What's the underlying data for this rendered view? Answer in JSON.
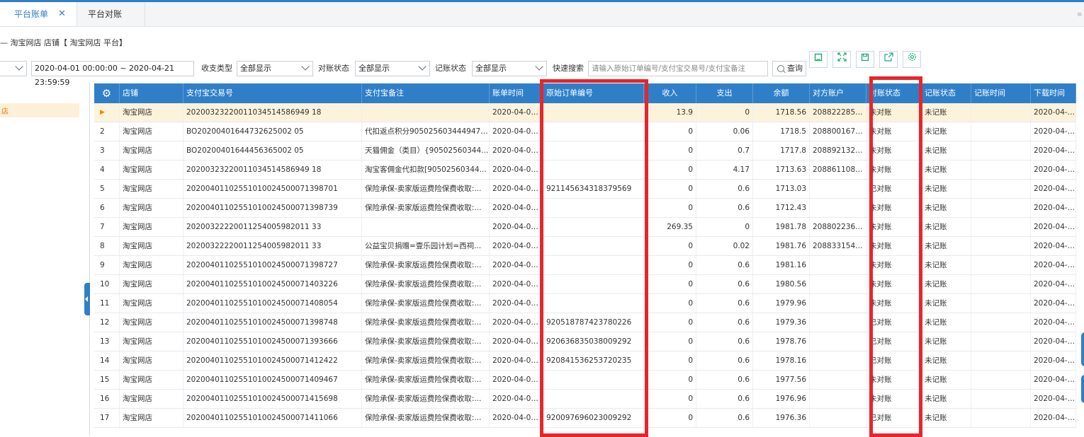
{
  "tabs": [
    {
      "label": "平台账单",
      "close": "✕",
      "active": true
    },
    {
      "label": "平台对账",
      "active": false
    }
  ],
  "breadcrumb": "— 淘宝网店 店铺【 淘宝网店 平台】",
  "filters": {
    "date_range": "2020-04-01 00:00:00 ~ 2020-04-21 23:59:59",
    "pay_type_label": "收支类型",
    "pay_type_value": "全部显示",
    "recon_label": "对账状态",
    "recon_value": "全部显示",
    "book_label": "记账状态",
    "book_value": "全部显示",
    "search_label": "快速搜索",
    "search_placeholder": "请输入原始订单编号/支付宝交易号/支付宝备注",
    "query_label": "查询"
  },
  "toolbar_icons": [
    "square-icon",
    "expand-icon",
    "save-icon",
    "export-icon",
    "settings-icon"
  ],
  "left_panel": {
    "selected_item": "店"
  },
  "columns": [
    "⚙",
    "店铺",
    "支付宝交易号",
    "支付宝备注",
    "账单时间",
    "原始订单编号",
    "收入",
    "支出",
    "余额",
    "对方账户",
    "对账状态",
    "记账状态",
    "记账时间",
    "下载时间"
  ],
  "rows": [
    {
      "idx": "▶",
      "shop": "淘宝网店",
      "trade_no": "20200323220011034514586949 18",
      "memo": "",
      "time": "2020-04-01 ...",
      "order_no": "",
      "income": "13.9",
      "expense": "0",
      "balance": "1718.56",
      "account": "20882228595...",
      "recon": "未对账",
      "book": "未记账",
      "book_time": "",
      "download": "2020-04-16 ..."
    },
    {
      "idx": "2",
      "shop": "淘宝网店",
      "trade_no": "BO20200401644732625002 05",
      "memo": "代扣返点积分9050256034449475...",
      "time": "2020-04-01 ...",
      "order_no": "",
      "income": "0",
      "expense": "0.06",
      "balance": "1718.5",
      "account": "20880016748...",
      "recon": "未对账",
      "book": "未记账",
      "book_time": "",
      "download": "2020-04-16 ..."
    },
    {
      "idx": "3",
      "shop": "淘宝网店",
      "trade_no": "BO20200401644456365002 05",
      "memo": "天猫佣金（类目）{90502560344...",
      "time": "2020-04-01 ...",
      "order_no": "",
      "income": "0",
      "expense": "0.7",
      "balance": "1717.8",
      "account": "20889213299...",
      "recon": "未对账",
      "book": "未记账",
      "book_time": "",
      "download": "2020-04-16 ..."
    },
    {
      "idx": "4",
      "shop": "淘宝网店",
      "trade_no": "20200323220011034514586949 18",
      "memo": "淘宝客佣金代扣款[90502560344...",
      "time": "2020-04-01 ...",
      "order_no": "",
      "income": "0",
      "expense": "4.17",
      "balance": "1713.63",
      "account": "20886110874...",
      "recon": "未对账",
      "book": "未记账",
      "book_time": "",
      "download": "2020-04-16 ..."
    },
    {
      "idx": "5",
      "shop": "淘宝网店",
      "trade_no": "20200401102551010024500071398701",
      "memo": "保险承保-卖家版运费险保费收取:...",
      "time": "2020-04-01 ...",
      "order_no": "921145634318379569",
      "income": "0",
      "expense": "0.6",
      "balance": "1713.03",
      "account": "",
      "recon": "已对账",
      "book": "未记账",
      "book_time": "",
      "download": "2020-04-16 ..."
    },
    {
      "idx": "6",
      "shop": "淘宝网店",
      "trade_no": "20200401102551010024500071398739",
      "memo": "保险承保-卖家版运费险保费收取:...",
      "time": "2020-04-01 ...",
      "order_no": "",
      "income": "0",
      "expense": "0.6",
      "balance": "1712.43",
      "account": "",
      "recon": "未对账",
      "book": "未记账",
      "book_time": "",
      "download": "2020-04-16 ..."
    },
    {
      "idx": "7",
      "shop": "淘宝网店",
      "trade_no": "20200322220011254005982011 33",
      "memo": "",
      "time": "2020-04-01 ...",
      "order_no": "",
      "income": "269.35",
      "expense": "0",
      "balance": "1981.78",
      "account": "20880223620...",
      "recon": "未对账",
      "book": "未记账",
      "book_time": "",
      "download": "2020-04-16 ..."
    },
    {
      "idx": "8",
      "shop": "淘宝网店",
      "trade_no": "20200322220011254005982011 33",
      "memo": "公益宝贝捐赠=壹乐园计划=西祠...",
      "time": "2020-04-01 ...",
      "order_no": "",
      "income": "0",
      "expense": "0.02",
      "balance": "1981.76",
      "account": "20883315424...",
      "recon": "未对账",
      "book": "未记账",
      "book_time": "",
      "download": "2020-04-16 ..."
    },
    {
      "idx": "9",
      "shop": "淘宝网店",
      "trade_no": "20200401102551010024500071398727",
      "memo": "保险承保-卖家版运费险保费收取:...",
      "time": "2020-04-01 ...",
      "order_no": "",
      "income": "0",
      "expense": "0.6",
      "balance": "1981.16",
      "account": "",
      "recon": "未对账",
      "book": "未记账",
      "book_time": "",
      "download": "2020-04-16 ..."
    },
    {
      "idx": "10",
      "shop": "淘宝网店",
      "trade_no": "20200401102551010024500071403226",
      "memo": "保险承保-卖家版运费险保费收取:...",
      "time": "2020-04-01 ...",
      "order_no": "",
      "income": "0",
      "expense": "0.6",
      "balance": "1980.56",
      "account": "",
      "recon": "未对账",
      "book": "未记账",
      "book_time": "",
      "download": "2020-04-16 ..."
    },
    {
      "idx": "11",
      "shop": "淘宝网店",
      "trade_no": "20200401102551010024500071408054",
      "memo": "保险承保-卖家版运费险保费收取:...",
      "time": "2020-04-01 ...",
      "order_no": "",
      "income": "0",
      "expense": "0.6",
      "balance": "1979.96",
      "account": "",
      "recon": "未对账",
      "book": "未记账",
      "book_time": "",
      "download": "2020-04-16 ..."
    },
    {
      "idx": "12",
      "shop": "淘宝网店",
      "trade_no": "20200401102551010024500071398748",
      "memo": "保险承保-卖家版运费险保费收取:...",
      "time": "2020-04-01 ...",
      "order_no": "920518787423780226",
      "income": "0",
      "expense": "0.6",
      "balance": "1979.36",
      "account": "",
      "recon": "已对账",
      "book": "未记账",
      "book_time": "",
      "download": "2020-04-16 ..."
    },
    {
      "idx": "13",
      "shop": "淘宝网店",
      "trade_no": "20200401102551010024500071393666",
      "memo": "保险承保-卖家版运费险保费收取:...",
      "time": "2020-04-01 ...",
      "order_no": "920636835038009292",
      "income": "0",
      "expense": "0.6",
      "balance": "1978.76",
      "account": "",
      "recon": "已对账",
      "book": "未记账",
      "book_time": "",
      "download": "2020-04-16 ..."
    },
    {
      "idx": "14",
      "shop": "淘宝网店",
      "trade_no": "20200401102551010024500071412422",
      "memo": "保险承保-卖家版运费险保费收取:...",
      "time": "2020-04-01 ...",
      "order_no": "920841536253720235",
      "income": "0",
      "expense": "0.6",
      "balance": "1978.16",
      "account": "",
      "recon": "已对账",
      "book": "未记账",
      "book_time": "",
      "download": "2020-04-16 ..."
    },
    {
      "idx": "15",
      "shop": "淘宝网店",
      "trade_no": "20200401102551010024500071409467",
      "memo": "保险承保-卖家版运费险保费收取:...",
      "time": "2020-04-01 ...",
      "order_no": "",
      "income": "0",
      "expense": "0.6",
      "balance": "1977.56",
      "account": "",
      "recon": "未对账",
      "book": "未记账",
      "book_time": "",
      "download": "2020-04-16 ..."
    },
    {
      "idx": "16",
      "shop": "淘宝网店",
      "trade_no": "20200401102551010024500071415698",
      "memo": "保险承保-卖家版运费险保费收取:...",
      "time": "2020-04-01 ...",
      "order_no": "",
      "income": "0",
      "expense": "0.6",
      "balance": "1976.96",
      "account": "",
      "recon": "未对账",
      "book": "未记账",
      "book_time": "",
      "download": "2020-04-16 ..."
    },
    {
      "idx": "17",
      "shop": "淘宝网店",
      "trade_no": "20200401102551010024500071411066",
      "memo": "保险承保-卖家版运费险保费收取:...",
      "time": "2020-04-01 ...",
      "order_no": "920097696023009292",
      "income": "0",
      "expense": "0.6",
      "balance": "1976.36",
      "account": "",
      "recon": "已对账",
      "book": "未记账",
      "book_time": "",
      "download": "2020-04-16 ..."
    }
  ],
  "colors": {
    "accent": "#2f7fc8",
    "highlight": "#e8252b",
    "selected_row": "#fdf3dc"
  }
}
